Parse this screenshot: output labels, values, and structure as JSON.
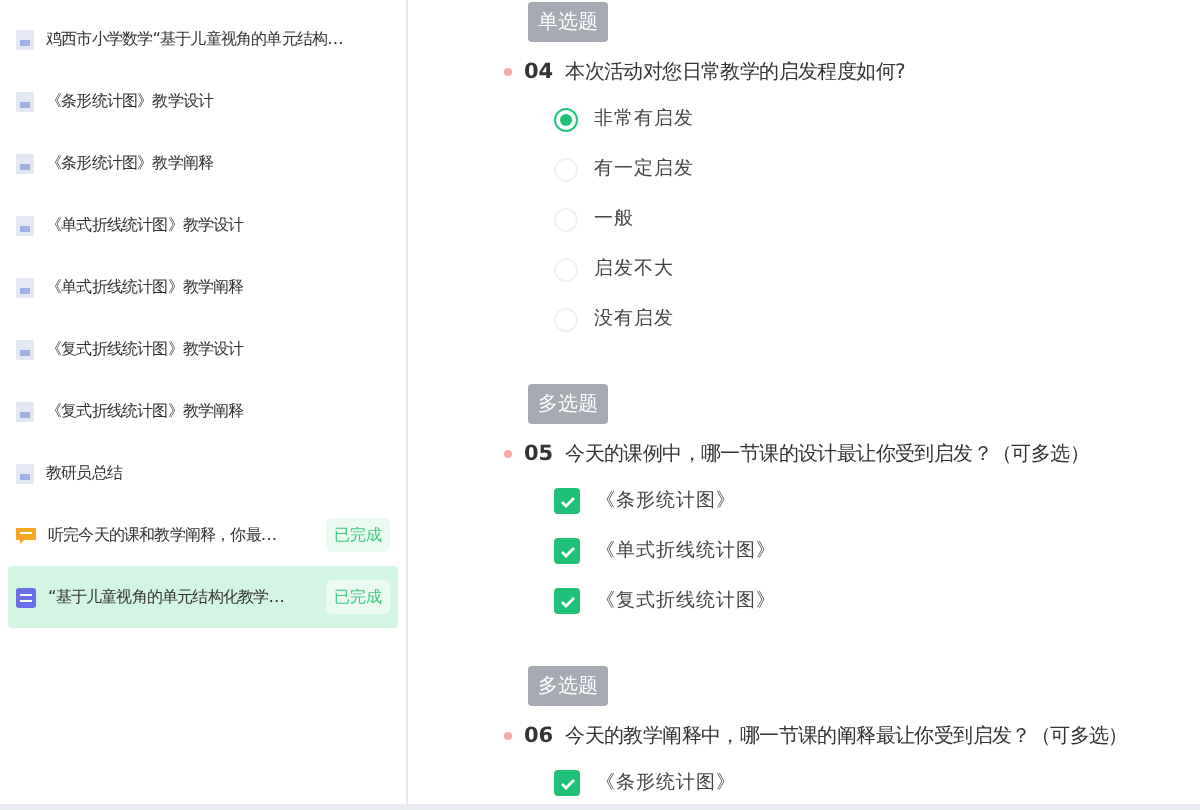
{
  "sidebar": {
    "items": [
      {
        "kind": "file",
        "label": "鸡西市小学数学“基于儿童视角的单元结构…",
        "selected": false
      },
      {
        "kind": "file",
        "label": "《条形统计图》教学设计",
        "selected": false
      },
      {
        "kind": "file",
        "label": "《条形统计图》教学阐释",
        "selected": false
      },
      {
        "kind": "file",
        "label": "《单式折线统计图》教学设计",
        "selected": false
      },
      {
        "kind": "file",
        "label": "《单式折线统计图》教学阐释",
        "selected": false
      },
      {
        "kind": "file",
        "label": "《复式折线统计图》教学设计",
        "selected": false
      },
      {
        "kind": "file",
        "label": "《复式折线统计图》教学阐释",
        "selected": false
      },
      {
        "kind": "file",
        "label": "教研员总结",
        "selected": false
      },
      {
        "kind": "chat",
        "label": "听完今天的课和教学阐释，你最…",
        "badge": "已完成",
        "selected": false
      },
      {
        "kind": "form",
        "label": "“基于儿童视角的单元结构化教学…",
        "badge": "已完成",
        "selected": true
      }
    ]
  },
  "questions": [
    {
      "type": "单选题",
      "kind": "radio",
      "required": true,
      "number": "04",
      "text": "本次活动对您日常教学的启发程度如何?",
      "options": [
        {
          "label": "非常有启发",
          "selected": true
        },
        {
          "label": "有一定启发",
          "selected": false
        },
        {
          "label": "一般",
          "selected": false
        },
        {
          "label": "启发不大",
          "selected": false
        },
        {
          "label": "没有启发",
          "selected": false
        }
      ]
    },
    {
      "type": "多选题",
      "kind": "checkbox",
      "required": true,
      "number": "05",
      "text": "今天的课例中，哪一节课的设计最让你受到启发？（可多选）",
      "options": [
        {
          "label": "《条形统计图》",
          "checked": true
        },
        {
          "label": "《单式折线统计图》",
          "checked": true
        },
        {
          "label": "《复式折线统计图》",
          "checked": true
        }
      ]
    },
    {
      "type": "多选题",
      "kind": "checkbox",
      "required": true,
      "number": "06",
      "text": "今天的教学阐释中，哪一节课的阐释最让你受到启发？（可多选）",
      "options": [
        {
          "label": "《条形统计图》",
          "checked": true
        }
      ]
    }
  ]
}
